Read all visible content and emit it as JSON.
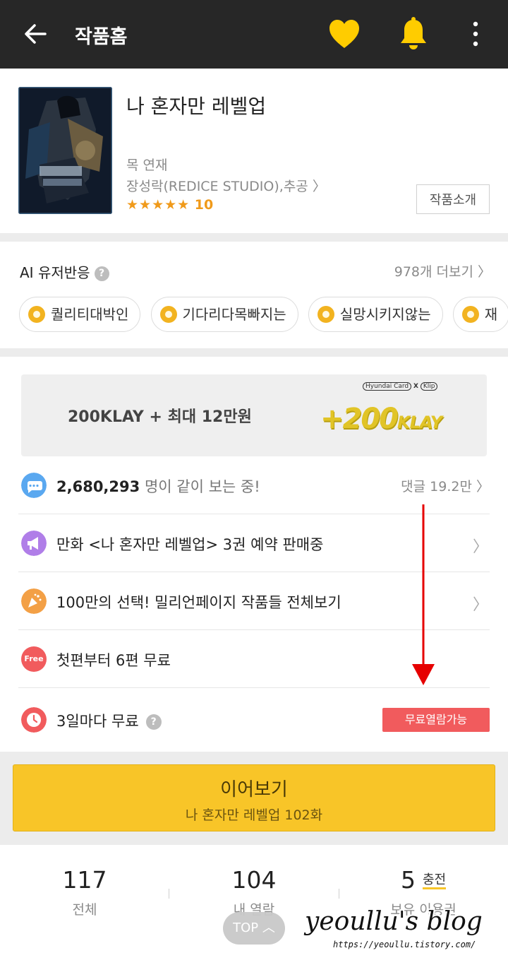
{
  "topbar": {
    "title": "작품홈",
    "icons": [
      "back-arrow-icon",
      "heart-icon",
      "bell-icon",
      "more-vertical-icon"
    ],
    "heart_color": "#ffcc00",
    "bell_color": "#ffcc00"
  },
  "work": {
    "title": "나 혼자만 레벨업",
    "schedule": "목 연재",
    "authors": "장성락(REDICE STUDIO),추공 〉",
    "stars": "★★★★★",
    "rating": "10",
    "intro_button": "작품소개"
  },
  "ai": {
    "label": "AI 유저반응",
    "help": "?",
    "more": "978개 더보기 〉",
    "chips": [
      "퀄리티대박인",
      "기다리다목빠지는",
      "실망시키지않는",
      "재"
    ]
  },
  "banner": {
    "text": "200KLAY + 최대 12만원",
    "brand_left": "Hyundai Card",
    "brand_x": "X",
    "brand_right": "Klip",
    "promo_plus": "+200",
    "promo_unit": "KLAY"
  },
  "rows": {
    "viewers_count": "2,680,293",
    "viewers_text": "명이 같이 보는 중!",
    "comments": "댓글 19.2만 〉",
    "preorder": "만화 <나 혼자만 레벨업> 3권 예약 판매중",
    "million": "100만의 선택! 밀리언페이지 작품들 전체보기",
    "free_icon": "Free",
    "free_first": "첫편부터 6편 무료",
    "every3": "3일마다 무료",
    "every3_badge": "무료열람가능"
  },
  "continue": {
    "label": "이어보기",
    "episode": "나 혼자만 레벨업 102화"
  },
  "stats": {
    "total": {
      "value": "117",
      "label": "전체"
    },
    "viewed": {
      "value": "104",
      "label": "내 열람"
    },
    "owned": {
      "value": "5",
      "label": "보유 이용권",
      "charge": "충전"
    }
  },
  "top_button": "TOP ︿",
  "watermark": "yeoullu's blog",
  "watermark_url": "https://yeoullu.tistory.com/",
  "colors": {
    "accent": "#f8c528",
    "badge": "#f15b5d",
    "star": "#f09a1a",
    "annotation_arrow": "#e60000"
  }
}
